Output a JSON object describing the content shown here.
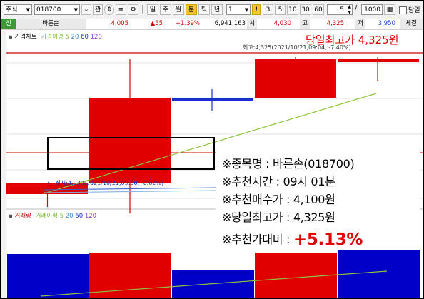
{
  "toolbar": {
    "market": "주식",
    "code": "018700",
    "view_btn": "관",
    "periods": [
      "일",
      "주",
      "월",
      "분",
      "틱",
      "년"
    ],
    "active_period": "분",
    "interval": "1",
    "warn_icon": "!",
    "minute_options": [
      "3",
      "5",
      "10",
      "30",
      "60"
    ],
    "count": "5",
    "ratio_slash": "/",
    "ratio": "1000",
    "ratio_icon": "chart-icon",
    "same_day_label": "당일"
  },
  "quote": {
    "badge": "신",
    "name": "바른손",
    "price": "4,005",
    "change": "▲55",
    "change_pct": "+1.39%",
    "volume": "6,941,163",
    "open_label": "시",
    "open": "4,030",
    "high_label": "고",
    "high": "4,325",
    "low_label": "저",
    "low": "3,950",
    "exec_label": "체결"
  },
  "chart": {
    "title": "가격차트",
    "ma_label": "가격이평",
    "ma_periods": [
      "5",
      "20",
      "60",
      "120"
    ],
    "high_text": "최고:4,325(2021/10/21,09:04, -7.40%)",
    "low_text": "최저:4,030(2021/10/21,09:00, -0.62%)",
    "headline": "당일최고가 4,325원",
    "volume_title": "거래량",
    "volume_ma_label": "거래이평",
    "volume_ma_periods": [
      "5",
      "20",
      "60",
      "120"
    ]
  },
  "chart_data": {
    "type": "candlestick",
    "title": "",
    "candles": [
      {
        "open": 4030,
        "close": 4005,
        "high": 4030,
        "low": 3975,
        "color": "#e00000"
      },
      {
        "open": 4030,
        "close": 4230,
        "high": 4320,
        "low": 3960,
        "color": "#e00000"
      },
      {
        "open": 4230,
        "close": 4230,
        "high": 4250,
        "low": 4200,
        "color": "#1a2fd0"
      },
      {
        "open": 4230,
        "close": 4320,
        "high": 4325,
        "low": 4230,
        "color": "#e00000"
      },
      {
        "open": 4320,
        "close": 4320,
        "high": 4325,
        "low": 4270,
        "color": "#e00000"
      }
    ],
    "volume_colors": [
      "#0000c8",
      "#e00000",
      "#0000c8",
      "#e00000",
      "#0000c8"
    ],
    "colors": {
      "up": "#e00000",
      "down": "#0000c8",
      "ma_line": "#8fc43a",
      "headline": "#e00000"
    }
  },
  "info": {
    "name_label": "※종목명 : 바른손(018700)",
    "time_label": "※추천시간 : 09시 01분",
    "buy_label": "※추천매수가 : 4,100원",
    "high_label": "※당일최고가 : 4,325원",
    "ratio_label": "※추천가대비 : ",
    "ratio_value": "+5.13%"
  }
}
